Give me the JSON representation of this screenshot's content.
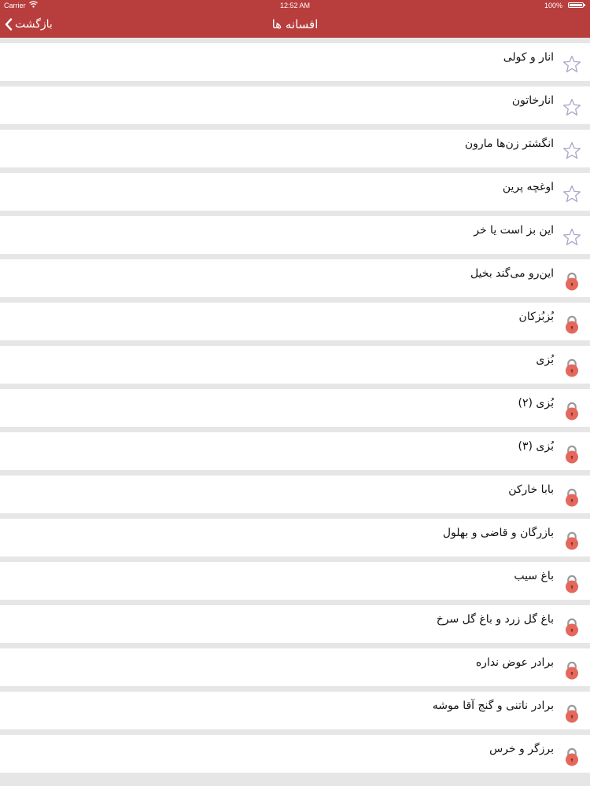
{
  "status_bar": {
    "carrier": "Carrier",
    "time": "12:52 AM",
    "battery": "100%"
  },
  "nav": {
    "back_label": "بازگشت",
    "title": "افسانه ها"
  },
  "colors": {
    "bar": "#b83d3d",
    "lock": "#e4685c",
    "star_stroke": "#a6a6c8",
    "separator": "#e6e6e6"
  },
  "stories": [
    {
      "title": "انار و کولی",
      "icon": "star-icon"
    },
    {
      "title": "انارخاتون",
      "icon": "star-icon"
    },
    {
      "title": "انگشتر زن‌ها مارون",
      "icon": "star-icon"
    },
    {
      "title": "اوغچه پرین",
      "icon": "star-icon"
    },
    {
      "title": "این بز است یا خر",
      "icon": "star-icon"
    },
    {
      "title": "این‌رو می‌گند بخیل",
      "icon": "lock-icon"
    },
    {
      "title": "بُزبُزکان",
      "icon": "lock-icon"
    },
    {
      "title": "بُزی",
      "icon": "lock-icon"
    },
    {
      "title": "بُزی (۲)",
      "icon": "lock-icon"
    },
    {
      "title": "بُزی (۳)",
      "icon": "lock-icon"
    },
    {
      "title": "بابا خارکن",
      "icon": "lock-icon"
    },
    {
      "title": "بازرگان و قاضی و بهلول",
      "icon": "lock-icon"
    },
    {
      "title": "باغ سیب",
      "icon": "lock-icon"
    },
    {
      "title": "باغ گل زرد و باغ گل سرخ",
      "icon": "lock-icon"
    },
    {
      "title": "برادر عوض نداره",
      "icon": "lock-icon"
    },
    {
      "title": "برادر ناتنی و گنج آقا موشه",
      "icon": "lock-icon"
    },
    {
      "title": "برزگر و خرس",
      "icon": "lock-icon"
    }
  ]
}
